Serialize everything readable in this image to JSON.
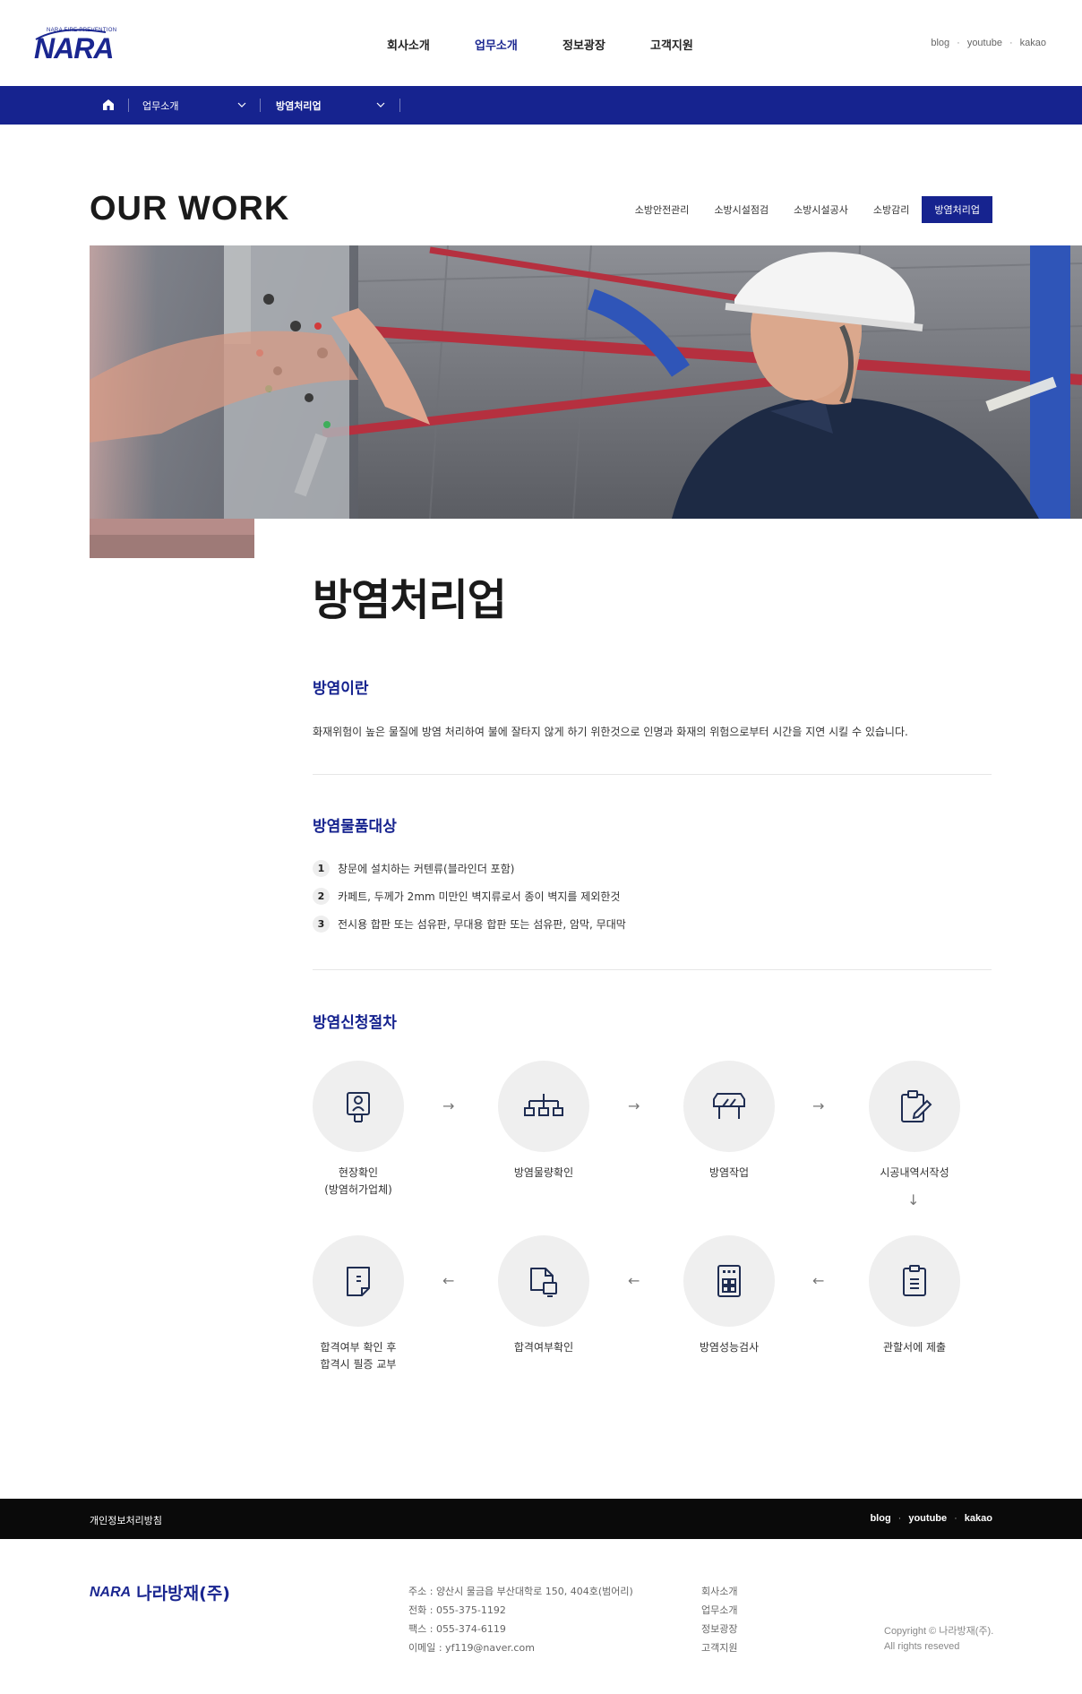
{
  "header": {
    "logo_tagline": "NARA FIRE PREVENTION",
    "logo_word": "NARA",
    "nav": [
      {
        "label": "회사소개"
      },
      {
        "label": "업무소개"
      },
      {
        "label": "정보광장"
      },
      {
        "label": "고객지원"
      }
    ],
    "active_nav": "업무소개",
    "links": [
      "blog",
      "youtube",
      "kakao"
    ]
  },
  "breadcrumb": {
    "level1": "업무소개",
    "level2": "방염처리업"
  },
  "section_heading": "OUR WORK",
  "subtabs": [
    {
      "label": "소방안전관리"
    },
    {
      "label": "소방시설점검"
    },
    {
      "label": "소방시설공사"
    },
    {
      "label": "소방감리"
    },
    {
      "label": "방염처리업"
    }
  ],
  "active_subtab": "방염처리업",
  "page_title": "방염처리업",
  "about": {
    "title": "방염이란",
    "text": "화재위험이 높은 물질에 방염 처리하여 불에 잘타지 않게 하기 위한것으로 인명과 화재의 위험으로부터 시간을 지연 시킬 수 있습니다."
  },
  "targets": {
    "title": "방염물품대상",
    "items": [
      {
        "num": "1",
        "text": "창문에 설치하는 커텐류(블라인더 포함)"
      },
      {
        "num": "2",
        "text": "카페트, 두께가 2mm 미만인 벽지류로서 종이 벽지를 제외한것"
      },
      {
        "num": "3",
        "text": "전시용 합판 또는 섬유판, 무대용 합판 또는 섬유판, 암막, 무대막"
      }
    ]
  },
  "procedure": {
    "title": "방염신청절차",
    "steps": [
      {
        "label_1": "현장확인",
        "label_2": "(방염허가업체)",
        "icon": "inspector-icon"
      },
      {
        "label_1": "방염물량확인",
        "label_2": "",
        "icon": "organization-chart-icon"
      },
      {
        "label_1": "방염작업",
        "label_2": "",
        "icon": "barrier-icon"
      },
      {
        "label_1": "시공내역서작성",
        "label_2": "",
        "icon": "clipboard-edit-icon"
      },
      {
        "label_1": "관할서에 제출",
        "label_2": "",
        "icon": "clipboard-list-icon"
      },
      {
        "label_1": "방염성능검사",
        "label_2": "",
        "icon": "building-icon"
      },
      {
        "label_1": "합격여부확인",
        "label_2": "",
        "icon": "document-check-icon"
      },
      {
        "label_1": "합격여부 확인 후",
        "label_2": "합격시 필증 교부",
        "icon": "certificate-icon"
      }
    ]
  },
  "footer": {
    "policy": "개인정보처리방침",
    "links": [
      "blog",
      "youtube",
      "kakao"
    ],
    "logo_en": "NARA",
    "logo_kr": "나라방재(주)",
    "info": [
      "주소 : 양산시 물금읍 부산대학로 150, 404호(범어리)",
      "전화 : 055-375-1192",
      "팩스 : 055-374-6119",
      "이메일 : yf119@naver.com"
    ],
    "menu": [
      "회사소개",
      "업무소개",
      "정보광장",
      "고객지원"
    ],
    "copyright_1": "Copyright © 나라방재(주).",
    "copyright_2": "All rights reseved"
  },
  "colors": {
    "brand_navy": "#16238f",
    "footer_bar": "#0a0a0a",
    "circle_bg": "#efefef"
  }
}
